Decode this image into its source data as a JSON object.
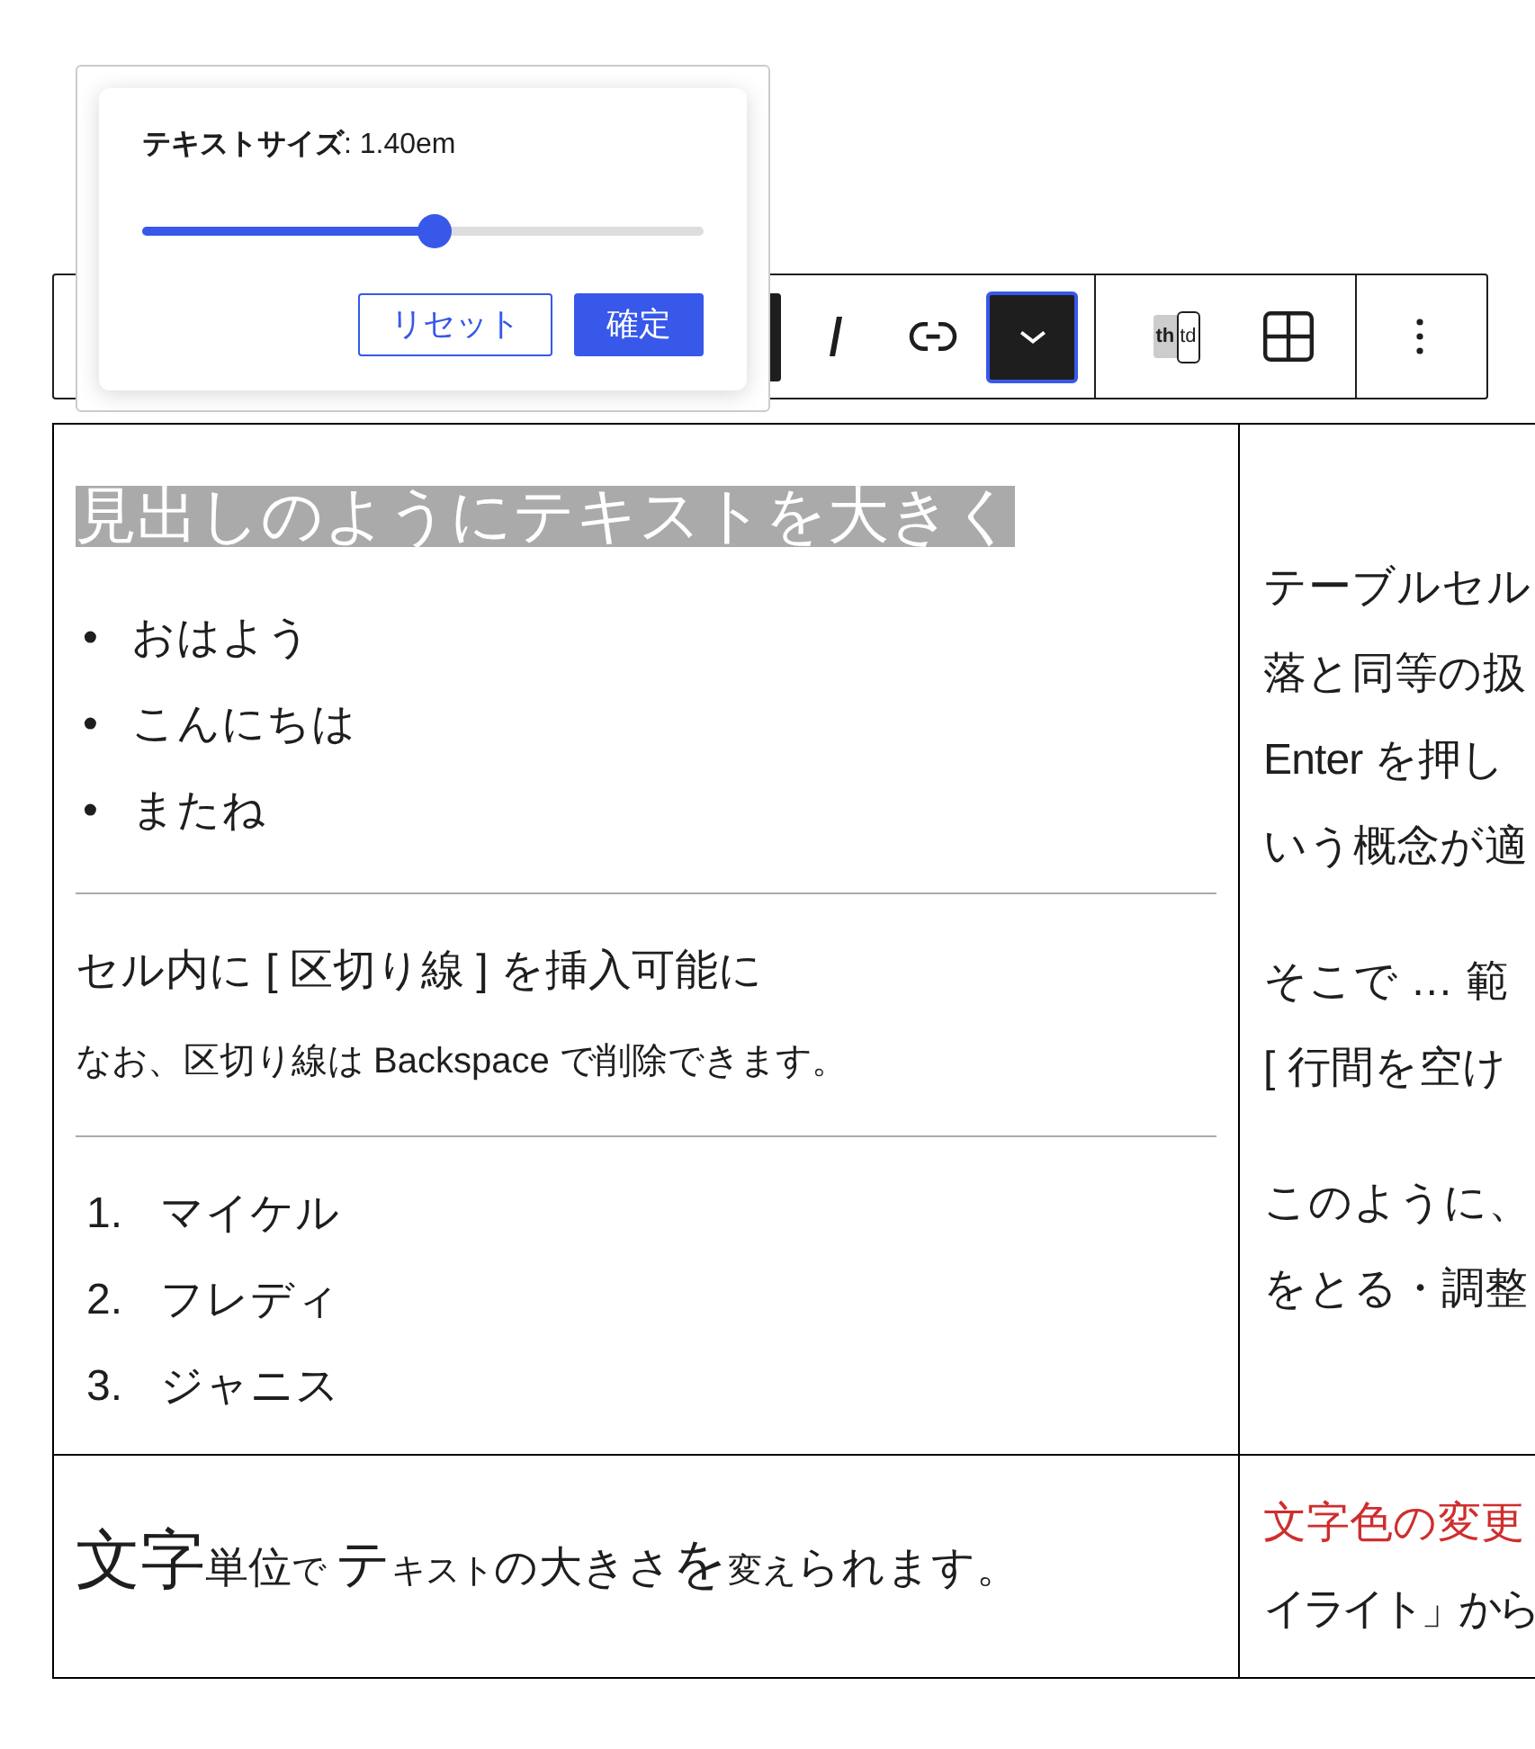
{
  "popover": {
    "label": "**テキストサイズ**: 1.40em",
    "slider": {
      "level": 0.52
    },
    "buttons": [
      {
        "kind": "secondary",
        "label": "リセット"
      },
      {
        "kind": "primary",
        "label": "確定"
      }
    ]
  },
  "toolbar": {
    "groups": [
      {
        "items": [
          {
            "kind": "covered",
            "pressed": true,
            "focused": false
          },
          {
            "kind": "italic",
            "pressed": false,
            "focused": false
          },
          {
            "kind": "link",
            "pressed": false,
            "focused": false
          },
          {
            "kind": "dropdown",
            "pressed": true,
            "focused": true
          }
        ]
      },
      {
        "items": [
          {
            "kind": "header-toggle",
            "labels": [
              "th",
              "td"
            ],
            "pressed": false,
            "focused": false
          },
          {
            "kind": "table",
            "pressed": false,
            "focused": false
          }
        ]
      },
      {
        "items": [
          {
            "kind": "more",
            "pressed": false,
            "focused": false
          }
        ]
      }
    ]
  },
  "table": {
    "rows": [
      {
        "cells": [
          {
            "blocks": [
              {
                "kind": "heading",
                "text": "見出しのようにテキストを大きく",
                "selected": true
              },
              {
                "kind": "bullet-list",
                "items": [
                  {
                    "marker": "•",
                    "text": "おはよう"
                  },
                  {
                    "marker": "•",
                    "text": "こんにちは"
                  },
                  {
                    "marker": "•",
                    "text": "またね"
                  }
                ]
              },
              {
                "kind": "separator"
              },
              {
                "kind": "paragraph",
                "text": "セル内に [ 区切り線 ] を挿入可能に"
              },
              {
                "kind": "note",
                "text": "なお、区切り線は Backspace で削除できます。"
              },
              {
                "kind": "separator"
              },
              {
                "kind": "ordered-list",
                "items": [
                  {
                    "marker": "1.",
                    "text": "マイケル"
                  },
                  {
                    "marker": "2.",
                    "text": "フレディ"
                  },
                  {
                    "marker": "3.",
                    "text": "ジャニス"
                  }
                ]
              }
            ]
          },
          {
            "blocks": [
              {
                "kind": "lines",
                "lines": [
                  {
                    "text": "テーブルセル"
                  },
                  {
                    "text": "落と同等の扱"
                  },
                  {
                    "text": "Enter を押し"
                  },
                  {
                    "text": "いう概念が適"
                  }
                ]
              },
              {
                "kind": "lines",
                "lines": [
                  {
                    "text": "そこで … 範"
                  },
                  {
                    "text": "[ 行間を空け"
                  }
                ]
              },
              {
                "kind": "lines",
                "lines": [
                  {
                    "text": "このように、"
                  },
                  {
                    "text": "をとる・調整"
                  }
                ]
              }
            ]
          }
        ]
      },
      {
        "cells": [
          {
            "blocks": [
              {
                "kind": "mixed",
                "runs": [
                  {
                    "kind": "huge",
                    "text": "文字"
                  },
                  {
                    "kind": "normal",
                    "text": "単位"
                  },
                  {
                    "kind": "small",
                    "text": "で "
                  },
                  {
                    "kind": "large",
                    "text": "テ"
                  },
                  {
                    "kind": "small",
                    "text": "キスト"
                  },
                  {
                    "kind": "normal",
                    "text": "の大きさ"
                  },
                  {
                    "kind": "large",
                    "text": "を"
                  },
                  {
                    "kind": "small",
                    "text": "変え"
                  },
                  {
                    "kind": "normal",
                    "text": "られます。"
                  }
                ]
              }
            ]
          },
          {
            "blocks": [
              {
                "kind": "lines",
                "lines": [
                  {
                    "text": "文字色の変更",
                    "color": "#cf2e2e"
                  },
                  {
                    "text": "イライト」から",
                    "color": "#1e1e1e"
                  }
                ]
              }
            ]
          }
        ]
      }
    ]
  }
}
